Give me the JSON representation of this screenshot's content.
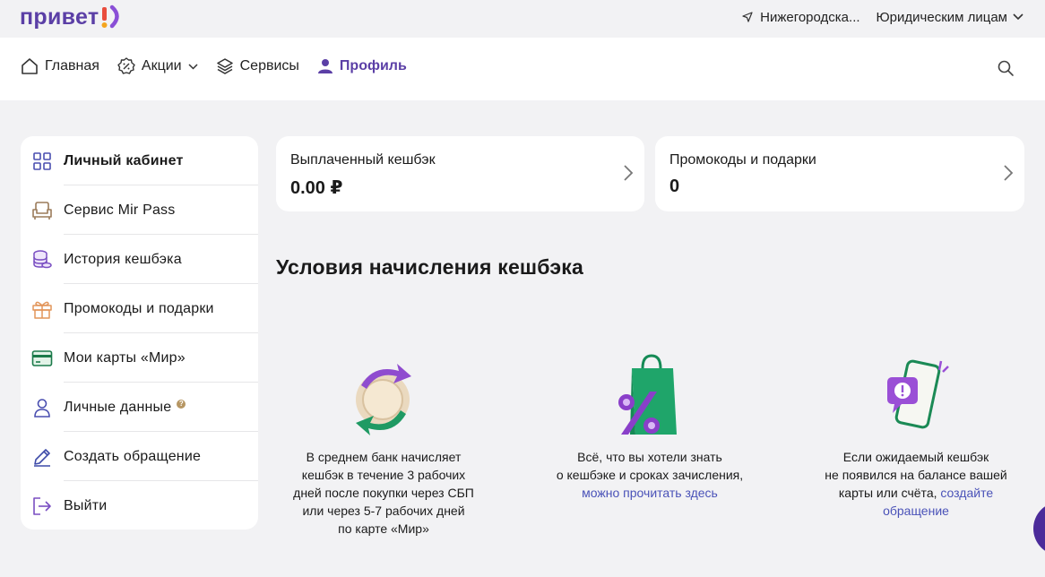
{
  "header": {
    "logo_text": "привет",
    "city": "Нижегородска...",
    "legal": "Юридическим лицам"
  },
  "nav": {
    "items": [
      {
        "label": "Главная",
        "icon": "home-icon"
      },
      {
        "label": "Акции",
        "icon": "discount-icon"
      },
      {
        "label": "Сервисы",
        "icon": "layers-icon"
      },
      {
        "label": "Профиль",
        "icon": "user-icon"
      }
    ],
    "active": "Профиль"
  },
  "sidebar": {
    "items": [
      {
        "label": "Личный кабинет",
        "icon": "grid-icon"
      },
      {
        "label": "Сервис Mir Pass",
        "icon": "armchair-icon"
      },
      {
        "label": "История кешбэка",
        "icon": "coins-icon"
      },
      {
        "label": "Промокоды и подарки",
        "icon": "gift-icon"
      },
      {
        "label": "Мои карты «Мир»",
        "icon": "card-icon"
      },
      {
        "label": "Личные данные",
        "icon": "person-icon"
      },
      {
        "label": "Создать обращение",
        "icon": "pen-icon"
      },
      {
        "label": "Выйти",
        "icon": "logout-icon"
      }
    ],
    "help_badge": "?"
  },
  "cards": {
    "cashback": {
      "title": "Выплаченный кешбэк",
      "value": "0.00 ₽"
    },
    "promo": {
      "title": "Промокоды и подарки",
      "value": "0"
    }
  },
  "conditions": {
    "title": "Условия начисления кешбэка",
    "items": [
      {
        "lines": [
          "В среднем банк начисляет",
          "кешбэк в течение 3 рабочих",
          "дней после покупки через СБП",
          "или через 5-7 рабочих дней",
          "по карте «Мир»"
        ],
        "illustration": "coin-exchange-icon"
      },
      {
        "lines": [
          "Всё, что вы хотели знать",
          "о кешбэке и сроках зачисления,"
        ],
        "link": "можно прочитать здесь",
        "illustration": "shopping-bag-percent-icon"
      },
      {
        "lines": [
          "Если ожидаемый кешбэк",
          "не появился на балансе вашей"
        ],
        "line_before_link": "карты или счёта, ",
        "link1": "создайте",
        "link2": "обращение",
        "illustration": "phone-alert-icon"
      }
    ]
  },
  "colors": {
    "brand": "#5b3fa6",
    "link": "#4a52b8",
    "background": "#f2f2f4"
  }
}
